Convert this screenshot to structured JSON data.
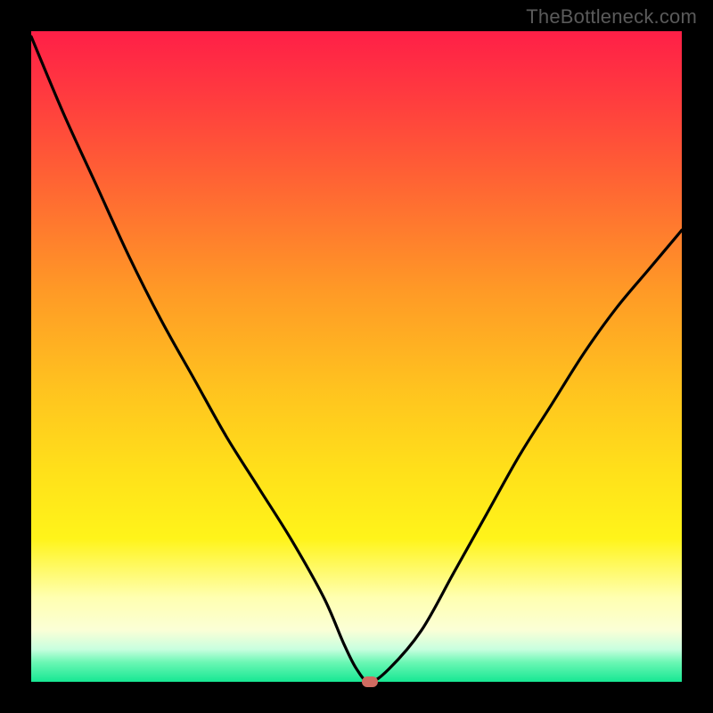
{
  "watermark": "TheBottleneck.com",
  "chart_data": {
    "type": "line",
    "title": "",
    "xlabel": "",
    "ylabel": "",
    "xlim": [
      0,
      100
    ],
    "ylim": [
      0,
      100
    ],
    "grid": false,
    "legend": false,
    "series": [
      {
        "name": "bottleneck-curve",
        "x": [
          0,
          5,
          10,
          15,
          20,
          25,
          30,
          35,
          40,
          45,
          48,
          50,
          52,
          55,
          60,
          65,
          70,
          75,
          80,
          85,
          90,
          95,
          100
        ],
        "values": [
          100,
          88,
          77,
          66,
          56,
          47,
          38,
          30,
          22,
          13,
          6,
          2,
          0,
          2,
          8,
          17,
          26,
          35,
          43,
          51,
          58,
          64,
          70
        ]
      }
    ],
    "marker": {
      "x": 52,
      "y": 0
    },
    "colors": {
      "curve": "#000000",
      "marker": "#cf6b61",
      "gradient_top": "#ff1f47",
      "gradient_bottom": "#17e793",
      "frame": "#000000"
    }
  }
}
